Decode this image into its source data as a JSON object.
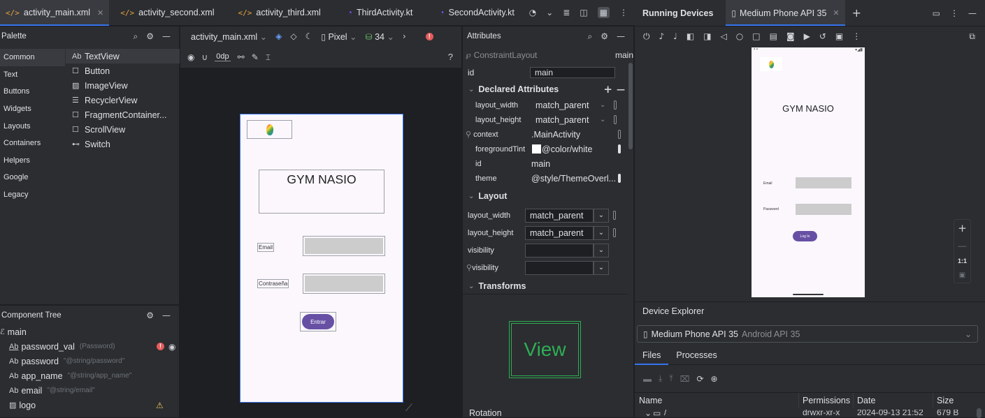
{
  "editor_tabs": [
    {
      "label": "activity_main.xml",
      "kind": "xml",
      "active": true
    },
    {
      "label": "activity_second.xml",
      "kind": "xml",
      "active": false
    },
    {
      "label": "activity_third.xml",
      "kind": "xml",
      "active": false
    },
    {
      "label": "ThirdActivity.kt",
      "kind": "kt",
      "active": false
    },
    {
      "label": "SecondActivity.kt",
      "kind": "kt",
      "active": false
    }
  ],
  "palette": {
    "title": "Palette",
    "categories": [
      "Common",
      "Text",
      "Buttons",
      "Widgets",
      "Layouts",
      "Containers",
      "Helpers",
      "Google",
      "Legacy"
    ],
    "items": [
      {
        "icon": "Ab",
        "label": "TextView"
      },
      {
        "icon": "☐",
        "label": "Button"
      },
      {
        "icon": "▨",
        "label": "ImageView"
      },
      {
        "icon": "☰",
        "label": "RecyclerView"
      },
      {
        "icon": "☐",
        "label": "FragmentContainer..."
      },
      {
        "icon": "☐",
        "label": "ScrollView"
      },
      {
        "icon": "⊷",
        "label": "Switch"
      }
    ]
  },
  "component_tree": {
    "title": "Component Tree",
    "items": [
      {
        "icon": "ℰ",
        "label": "main",
        "hint": "",
        "indent": 0
      },
      {
        "icon": "Ab",
        "label": "password_val",
        "hint": "(Password)",
        "indent": 1,
        "error": true
      },
      {
        "icon": "Ab",
        "label": "password",
        "hint": "\"@string/password\"",
        "indent": 1
      },
      {
        "icon": "Ab",
        "label": "app_name",
        "hint": "\"@string/app_name\"",
        "indent": 1
      },
      {
        "icon": "Ab",
        "label": "email",
        "hint": "\"@string/email\"",
        "indent": 1
      },
      {
        "icon": "▨",
        "label": "logo",
        "hint": "",
        "indent": 1,
        "warning": true
      }
    ]
  },
  "design_toolbar": {
    "file": "activity_main.xml",
    "device": "Pixel",
    "api": "34",
    "margin": "0dp",
    "help": "?"
  },
  "layout_preview": {
    "title": "GYM NASIO",
    "email_label": "Email",
    "password_label": "Contraseña",
    "button_label": "Entrar"
  },
  "attributes": {
    "title": "Attributes",
    "component_type": "ConstraintLayout",
    "component_id": "main",
    "id_label": "id",
    "id_value": "main",
    "declared_title": "Declared Attributes",
    "declared": [
      {
        "key": "layout_width",
        "value": "match_parent"
      },
      {
        "key": "layout_height",
        "value": "match_parent"
      },
      {
        "key": "context",
        "value": ".MainActivity"
      },
      {
        "key": "foregroundTint",
        "value": "@color/white"
      },
      {
        "key": "id",
        "value": "main"
      },
      {
        "key": "theme",
        "value": "@style/ThemeOverl..."
      }
    ],
    "layout_title": "Layout",
    "layout": [
      {
        "key": "layout_width",
        "value": "match_parent"
      },
      {
        "key": "layout_height",
        "value": "match_parent"
      },
      {
        "key": "visibility",
        "value": ""
      },
      {
        "key": "visibility",
        "value": ""
      }
    ],
    "transforms_title": "Transforms",
    "view_label": "View",
    "rotation_label": "Rotation"
  },
  "running_devices": {
    "title": "Running Devices",
    "device_tab": "Medium Phone API 35",
    "app_title": "GYM NASIO",
    "email_label": "Email",
    "password_label": "Password",
    "button_label": "Log In",
    "zoom_label": "1:1"
  },
  "device_explorer": {
    "title": "Device Explorer",
    "device": "Medium Phone API 35",
    "device_api": "Android API 35",
    "tabs": [
      "Files",
      "Processes"
    ],
    "columns": [
      "Name",
      "Permissions",
      "Date",
      "Size"
    ],
    "row": {
      "name": "/",
      "permissions": "drwxr-xr-x",
      "date": "2024-09-13 21:52",
      "size": "679 B"
    }
  },
  "colors": {
    "accent": "#3574f0",
    "button": "#6750a4",
    "error": "#e55b5b",
    "warning": "#f2c55c"
  }
}
